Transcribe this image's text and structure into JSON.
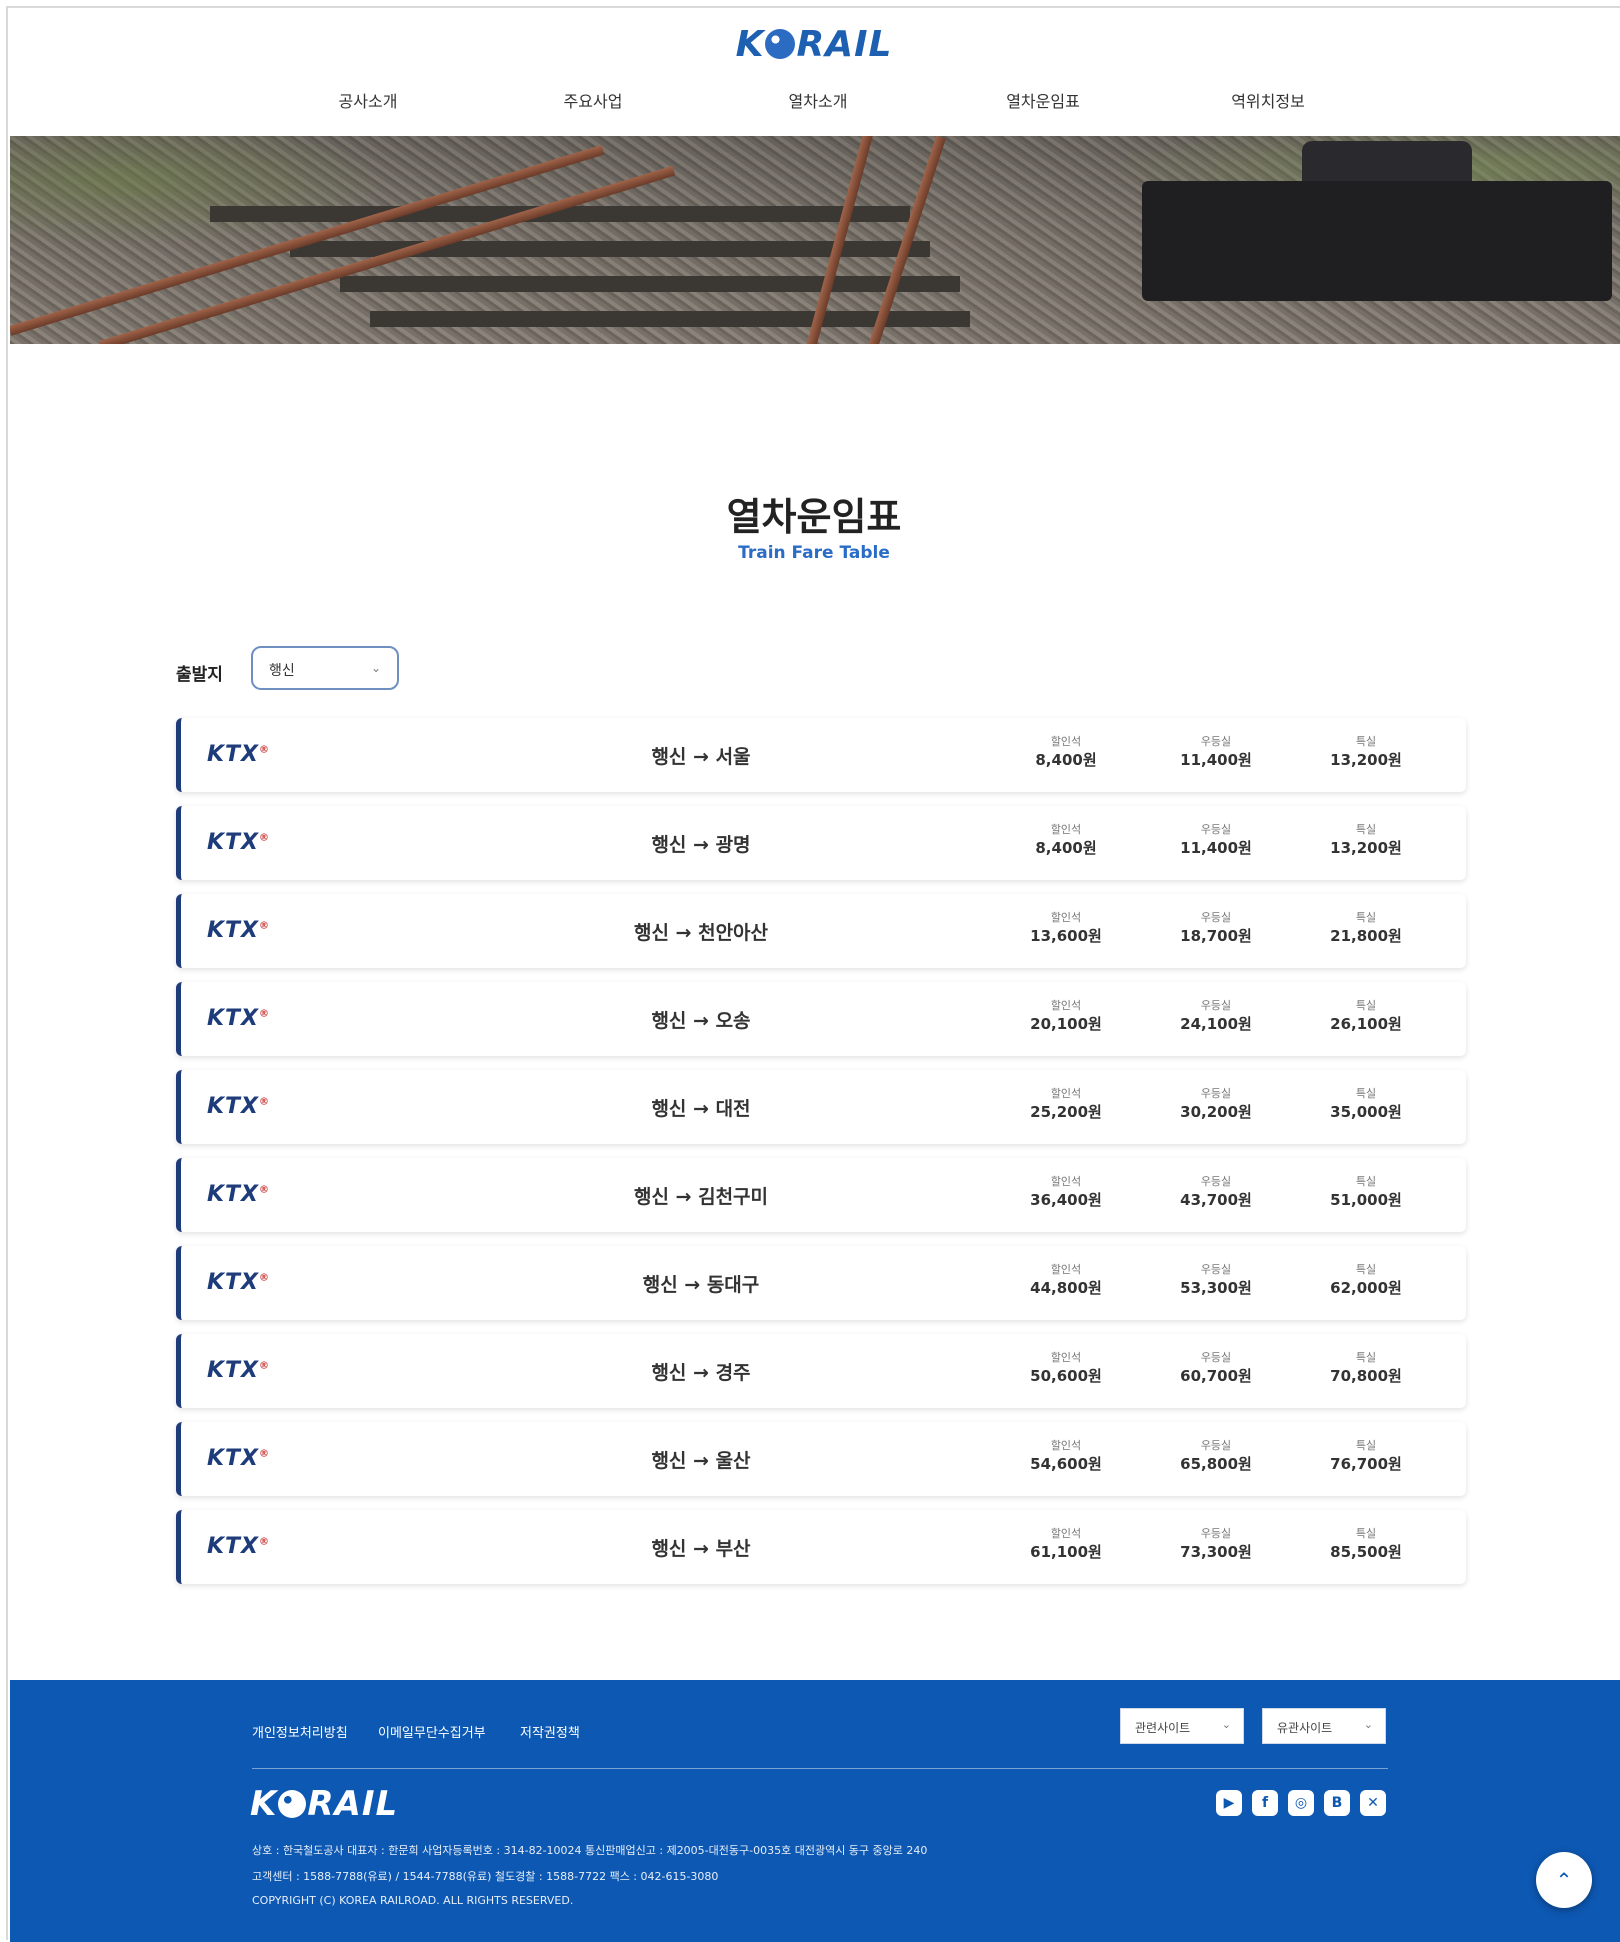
{
  "brand": {
    "logo_left": "K",
    "logo_right": "RAIL"
  },
  "nav": {
    "items": [
      "공사소개",
      "주요사업",
      "열차소개",
      "열차운임표",
      "역위치정보"
    ]
  },
  "page": {
    "title": "열차운임표",
    "subtitle": "Train Fare Table"
  },
  "filter": {
    "label": "출발지",
    "selected": "행신"
  },
  "fare_labels": {
    "discount": "할인석",
    "standard": "우등실",
    "special": "특실"
  },
  "train_logo": {
    "text": "KTX",
    "mark": "®"
  },
  "rows": [
    {
      "route": "행신 → 서울",
      "discount": "8,400원",
      "standard": "11,400원",
      "special": "13,200원"
    },
    {
      "route": "행신 → 광명",
      "discount": "8,400원",
      "standard": "11,400원",
      "special": "13,200원"
    },
    {
      "route": "행신 → 천안아산",
      "discount": "13,600원",
      "standard": "18,700원",
      "special": "21,800원"
    },
    {
      "route": "행신 → 오송",
      "discount": "20,100원",
      "standard": "24,100원",
      "special": "26,100원"
    },
    {
      "route": "행신 → 대전",
      "discount": "25,200원",
      "standard": "30,200원",
      "special": "35,000원"
    },
    {
      "route": "행신 → 김천구미",
      "discount": "36,400원",
      "standard": "43,700원",
      "special": "51,000원"
    },
    {
      "route": "행신 → 동대구",
      "discount": "44,800원",
      "standard": "53,300원",
      "special": "62,000원"
    },
    {
      "route": "행신 → 경주",
      "discount": "50,600원",
      "standard": "60,700원",
      "special": "70,800원"
    },
    {
      "route": "행신 → 울산",
      "discount": "54,600원",
      "standard": "65,800원",
      "special": "76,700원"
    },
    {
      "route": "행신 → 부산",
      "discount": "61,100원",
      "standard": "73,300원",
      "special": "85,500원"
    }
  ],
  "footer": {
    "links": [
      "개인정보처리방침",
      "이메일무단수집거부",
      "저작권정책"
    ],
    "selects": [
      "관련사이트",
      "유관사이트"
    ],
    "social_icons": [
      "youtube-icon",
      "facebook-icon",
      "instagram-icon",
      "blog-icon",
      "twitter-icon"
    ],
    "social_glyphs": [
      "▶",
      "f",
      "◎",
      "B",
      "✕"
    ],
    "info_lines": [
      "상호 : 한국철도공사    대표자 : 한문희    사업자등록번호 : 314-82-10024    통신판매업신고 : 제2005-대전동구-0035호    대전광역시 동구 중앙로 240",
      "고객센터 : 1588-7788(유료) / 1544-7788(유료)    철도경찰 : 1588-7722    팩스 : 042-615-3080",
      "COPYRIGHT (C) KOREA RAILROAD. ALL RIGHTS RESERVED."
    ],
    "top_button": "⌃"
  },
  "colors": {
    "brand_blue": "#0d58b3",
    "accent_blue": "#2a6cc6",
    "row_accent": "#1f3c7a"
  }
}
